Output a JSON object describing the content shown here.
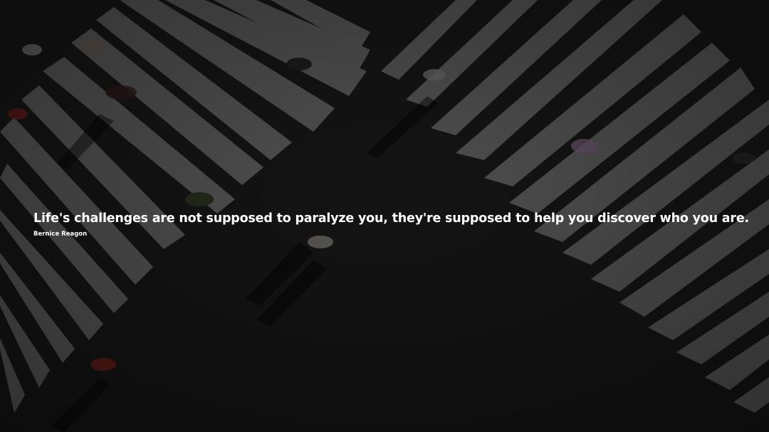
{
  "quote": {
    "text": "Life's challenges are not supposed to paralyze you, they're supposed to help you discover who you are.",
    "author": "Bernice Reagon"
  },
  "colors": {
    "asphalt": "#262626",
    "stripe": "#e6e6e6",
    "overlay": "#000000",
    "text": "#ffffff"
  }
}
